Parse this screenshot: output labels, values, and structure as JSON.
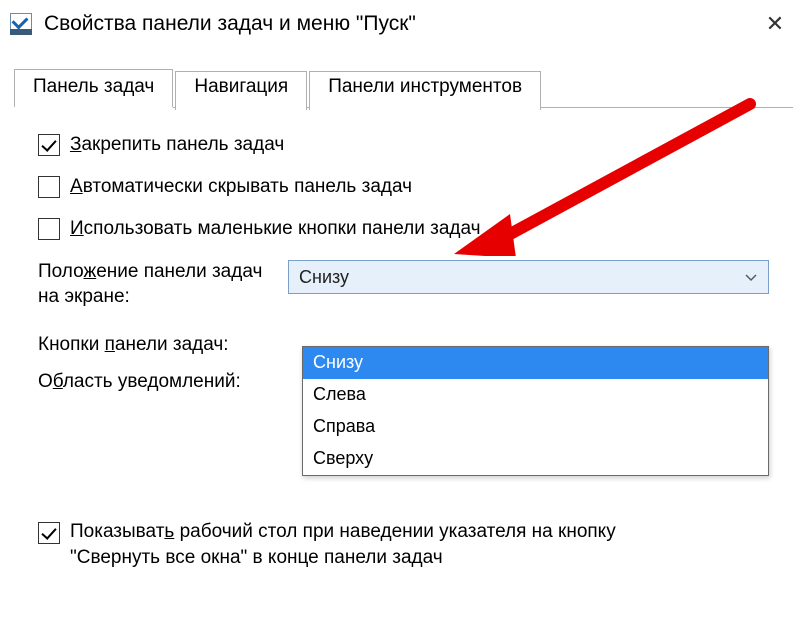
{
  "window": {
    "title": "Свойства панели задач и меню \"Пуск\""
  },
  "tabs": [
    {
      "label": "Панель задач",
      "active": true
    },
    {
      "label": "Навигация",
      "active": false
    },
    {
      "label": "Панели инструментов",
      "active": false
    }
  ],
  "checkboxes": {
    "lock": {
      "label_pre": "З",
      "label_rest": "акрепить панель задач",
      "checked": true
    },
    "autohide": {
      "label_pre": "А",
      "label_rest": "втоматически скрывать панель задач",
      "checked": false
    },
    "small": {
      "label_pre": "И",
      "label_rest": "спользовать маленькие кнопки панели задач",
      "checked": false
    }
  },
  "position": {
    "label_part1": "Поло",
    "label_under": "ж",
    "label_part2": "ение панели задач на экране:",
    "value": "Снизу",
    "options": [
      "Снизу",
      "Слева",
      "Справа",
      "Сверху"
    ],
    "selected_index": 0
  },
  "buttons_label": {
    "part1": "Кнопки ",
    "under": "п",
    "part2": "анели задач:"
  },
  "notify_label": {
    "part1": "О",
    "under": "б",
    "part2": "ласть уведомлений:"
  },
  "peek": {
    "checked": true,
    "line1_pre": "Показыват",
    "line1_under": "ь",
    "line1_post": " рабочий стол при наведении указателя на кнопку",
    "line2": "\"Свернуть все окна\" в конце панели задач"
  }
}
